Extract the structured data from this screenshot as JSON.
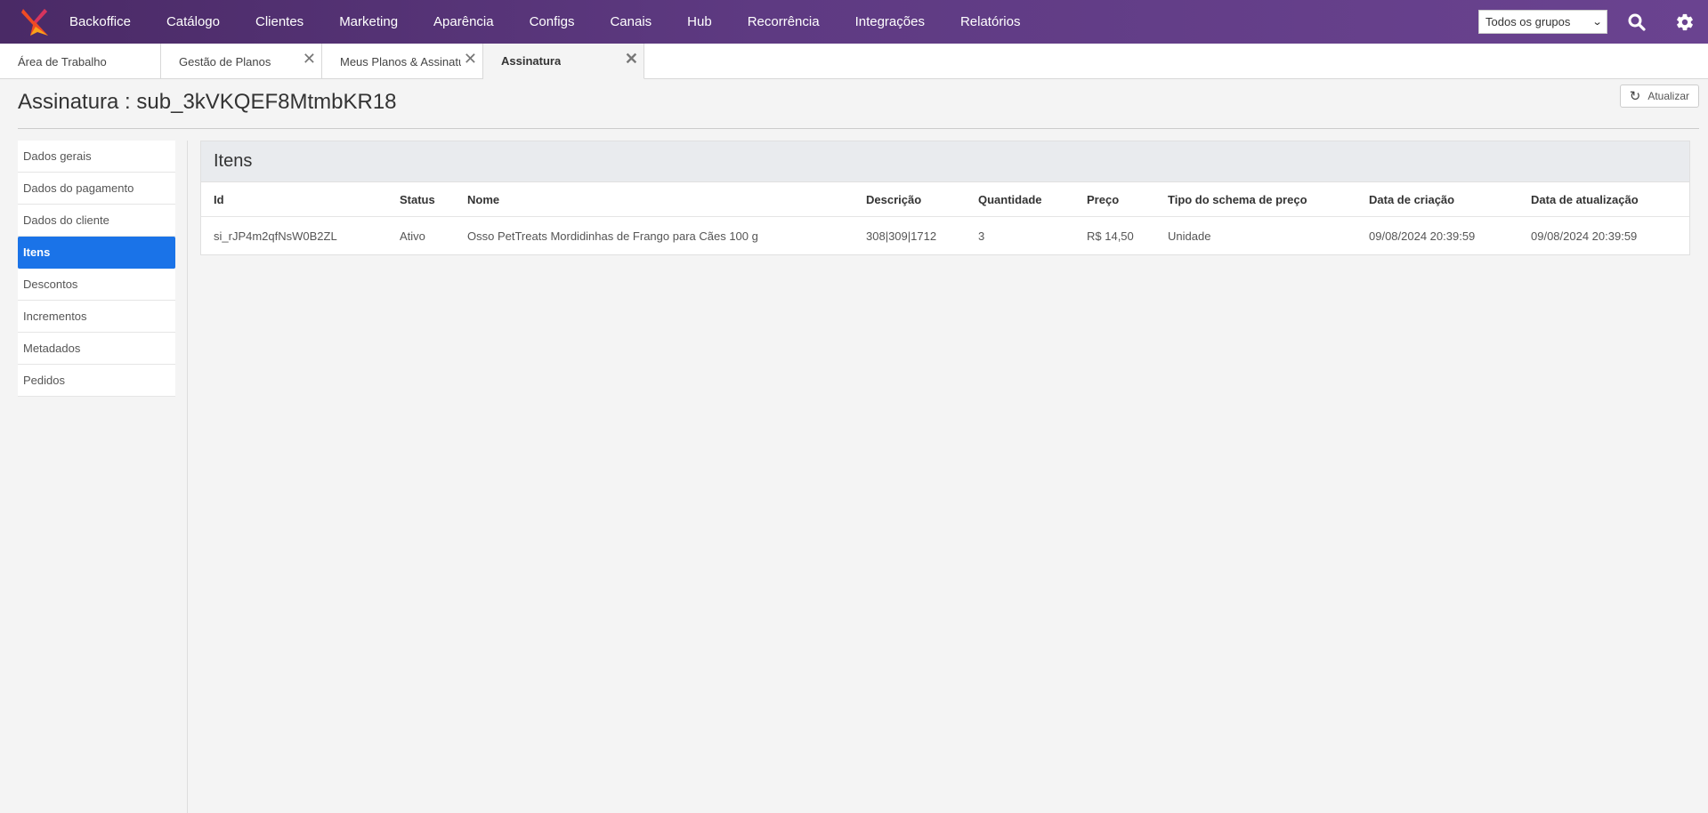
{
  "nav": {
    "items": [
      "Backoffice",
      "Catálogo",
      "Clientes",
      "Marketing",
      "Aparência",
      "Configs",
      "Canais",
      "Hub",
      "Recorrência",
      "Integrações",
      "Relatórios"
    ],
    "group_select": "Todos os grupos"
  },
  "tabs": [
    {
      "label": "Área de Trabalho",
      "closable": false
    },
    {
      "label": "Gestão de Planos",
      "closable": true
    },
    {
      "label": "Meus Planos & Assinaturas",
      "closable": true
    },
    {
      "label": "Assinatura",
      "closable": true,
      "active": true
    }
  ],
  "page": {
    "title": "Assinatura : sub_3kVKQEF8MtmbKR18",
    "refresh_label": "Atualizar"
  },
  "sidemenu": {
    "items": [
      "Dados gerais",
      "Dados do pagamento",
      "Dados do cliente",
      "Itens",
      "Descontos",
      "Incrementos",
      "Metadados",
      "Pedidos"
    ],
    "active": "Itens"
  },
  "items_panel": {
    "title": "Itens",
    "columns": [
      "Id",
      "Status",
      "Nome",
      "Descrição",
      "Quantidade",
      "Preço",
      "Tipo do schema de preço",
      "Data de criação",
      "Data de atualização"
    ],
    "rows": [
      [
        "si_rJP4m2qfNsW0B2ZL",
        "Ativo",
        "Osso PetTreats Mordidinhas de Frango para Cães 100 g",
        "308|309|1712",
        "3",
        "R$ 14,50",
        "Unidade",
        "09/08/2024 20:39:59",
        "09/08/2024 20:39:59"
      ]
    ]
  },
  "colors": {
    "nav_bg": "#5e3a82",
    "active_menu": "#1a73e8"
  }
}
